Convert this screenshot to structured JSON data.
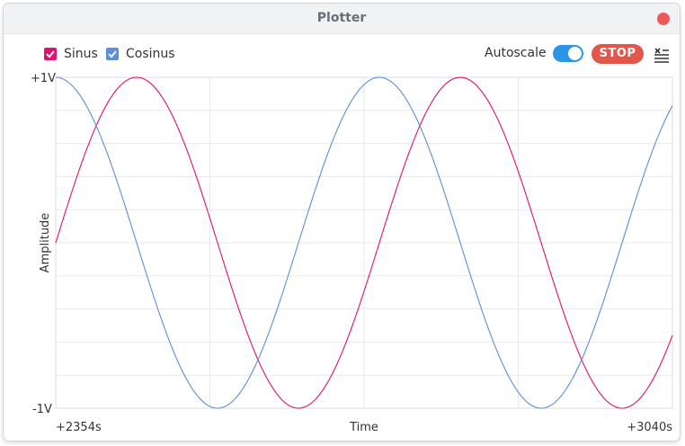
{
  "window": {
    "title": "Plotter"
  },
  "legend": [
    {
      "label": "Sinus",
      "checked": true,
      "color": "#e0116f"
    },
    {
      "label": "Cosinus",
      "checked": true,
      "color": "#5b8fdc"
    }
  ],
  "controls": {
    "autoscale_label": "Autoscale",
    "autoscale_on": true,
    "stop_label": "STOP"
  },
  "icons": {
    "close": "close-icon",
    "clear": "clear-list-icon"
  },
  "colors": {
    "accent": "#2b95e8",
    "stop": "#e2574c",
    "close": "#ee5a5a",
    "grid": "#e9e9e9"
  },
  "chart_data": {
    "type": "line",
    "xlabel": "Time",
    "ylabel": "Amplitude",
    "x_tick_labels": {
      "start": "+2354s",
      "end": "+3040s"
    },
    "y_tick_labels": {
      "top": "+1V",
      "bottom": "-1V"
    },
    "ylim": [
      -1,
      1
    ],
    "xlim": [
      2354,
      3040
    ],
    "grid": true,
    "series": [
      {
        "name": "Sinus",
        "color": "#e0116f",
        "function": "sin",
        "period_s": 360,
        "phase_rad": 0
      },
      {
        "name": "Cosinus",
        "color": "#5b8fdc",
        "function": "cos",
        "period_s": 360,
        "phase_rad": 0
      }
    ]
  }
}
